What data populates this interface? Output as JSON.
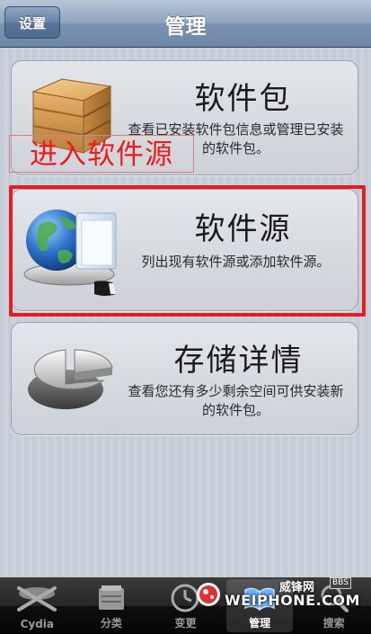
{
  "navbar": {
    "title": "管理",
    "back_label": "设置"
  },
  "cards": [
    {
      "title": "软件包",
      "description": "查看已安装软件包信息或管理已安装的软件包。",
      "icon": "wooden-box-icon"
    },
    {
      "title": "软件源",
      "description": "列出现有软件源或添加软件源。",
      "icon": "globe-folder-icon"
    },
    {
      "title": "存储详情",
      "description": "查看您还有多少剩余空间可供安装新的软件包。",
      "icon": "pie-chart-icon"
    }
  ],
  "annotation": {
    "text": "进入软件源",
    "color": "#ef1a1a"
  },
  "tabbar": {
    "items": [
      {
        "label": "Cydia",
        "icon": "cydia-icon",
        "active": false
      },
      {
        "label": "分类",
        "icon": "categories-icon",
        "active": false
      },
      {
        "label": "变更",
        "icon": "clock-icon",
        "active": false
      },
      {
        "label": "管理",
        "icon": "manage-book-icon",
        "active": true
      },
      {
        "label": "搜索",
        "icon": "search-icon",
        "active": false
      }
    ]
  },
  "watermark": {
    "top_text": "威锋网",
    "bbs": "BBS",
    "main_text": "WEIPHONE.COM"
  }
}
